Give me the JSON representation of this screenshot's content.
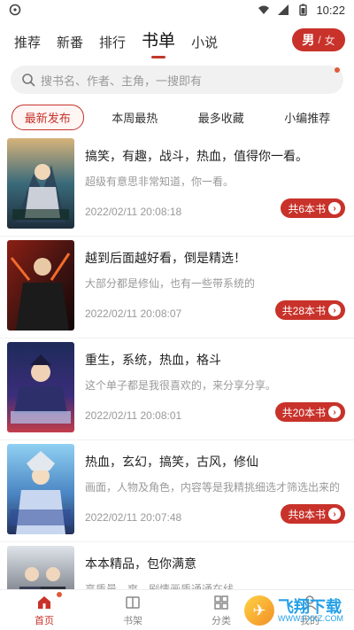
{
  "status_bar": {
    "time": "10:22"
  },
  "top_tabs": [
    {
      "label": "推荐",
      "active": false
    },
    {
      "label": "新番",
      "active": false
    },
    {
      "label": "排行",
      "active": false
    },
    {
      "label": "书单",
      "active": true
    },
    {
      "label": "小说",
      "active": false
    }
  ],
  "gender_toggle": {
    "on": "男",
    "sep": "/",
    "off": "女"
  },
  "search": {
    "placeholder": "搜书名、作者、主角，一搜即有"
  },
  "filters": [
    {
      "label": "最新发布",
      "active": true
    },
    {
      "label": "本周最热",
      "active": false
    },
    {
      "label": "最多收藏",
      "active": false
    },
    {
      "label": "小编推荐",
      "active": false
    }
  ],
  "lists": [
    {
      "title": "搞笑，有趣，战斗，热血，值得你一看。",
      "desc": "超级有意思非常知道，你一看。",
      "time": "2022/02/11 20:08:18",
      "count": "共6本书"
    },
    {
      "title": "越到后面越好看，倒是精选！",
      "desc": "大部分都是修仙，也有一些带系统的",
      "time": "2022/02/11 20:08:07",
      "count": "共28本书"
    },
    {
      "title": "重生，系统，热血，格斗",
      "desc": "这个单子都是我很喜欢的，来分享分享。",
      "time": "2022/02/11 20:08:01",
      "count": "共20本书"
    },
    {
      "title": "热血，玄幻，搞笑，古风，修仙",
      "desc": "画面，人物及角色，内容等是我精挑细选才筛选出来的",
      "time": "2022/02/11 20:07:48",
      "count": "共8本书"
    },
    {
      "title": "本本精品，包你满意",
      "desc": "高质量，爽，剧情画质通通在线",
      "time": "",
      "count": ""
    }
  ],
  "bottom_nav": [
    {
      "label": "首页",
      "active": true
    },
    {
      "label": "书架",
      "active": false
    },
    {
      "label": "分类",
      "active": false
    },
    {
      "label": "我的",
      "active": false
    }
  ],
  "watermark": {
    "main": "飞翔下载",
    "sub": "WWW.FXXZ.COM"
  },
  "colors": {
    "accent": "#c8322a",
    "text": "#222222",
    "muted": "#999999"
  }
}
